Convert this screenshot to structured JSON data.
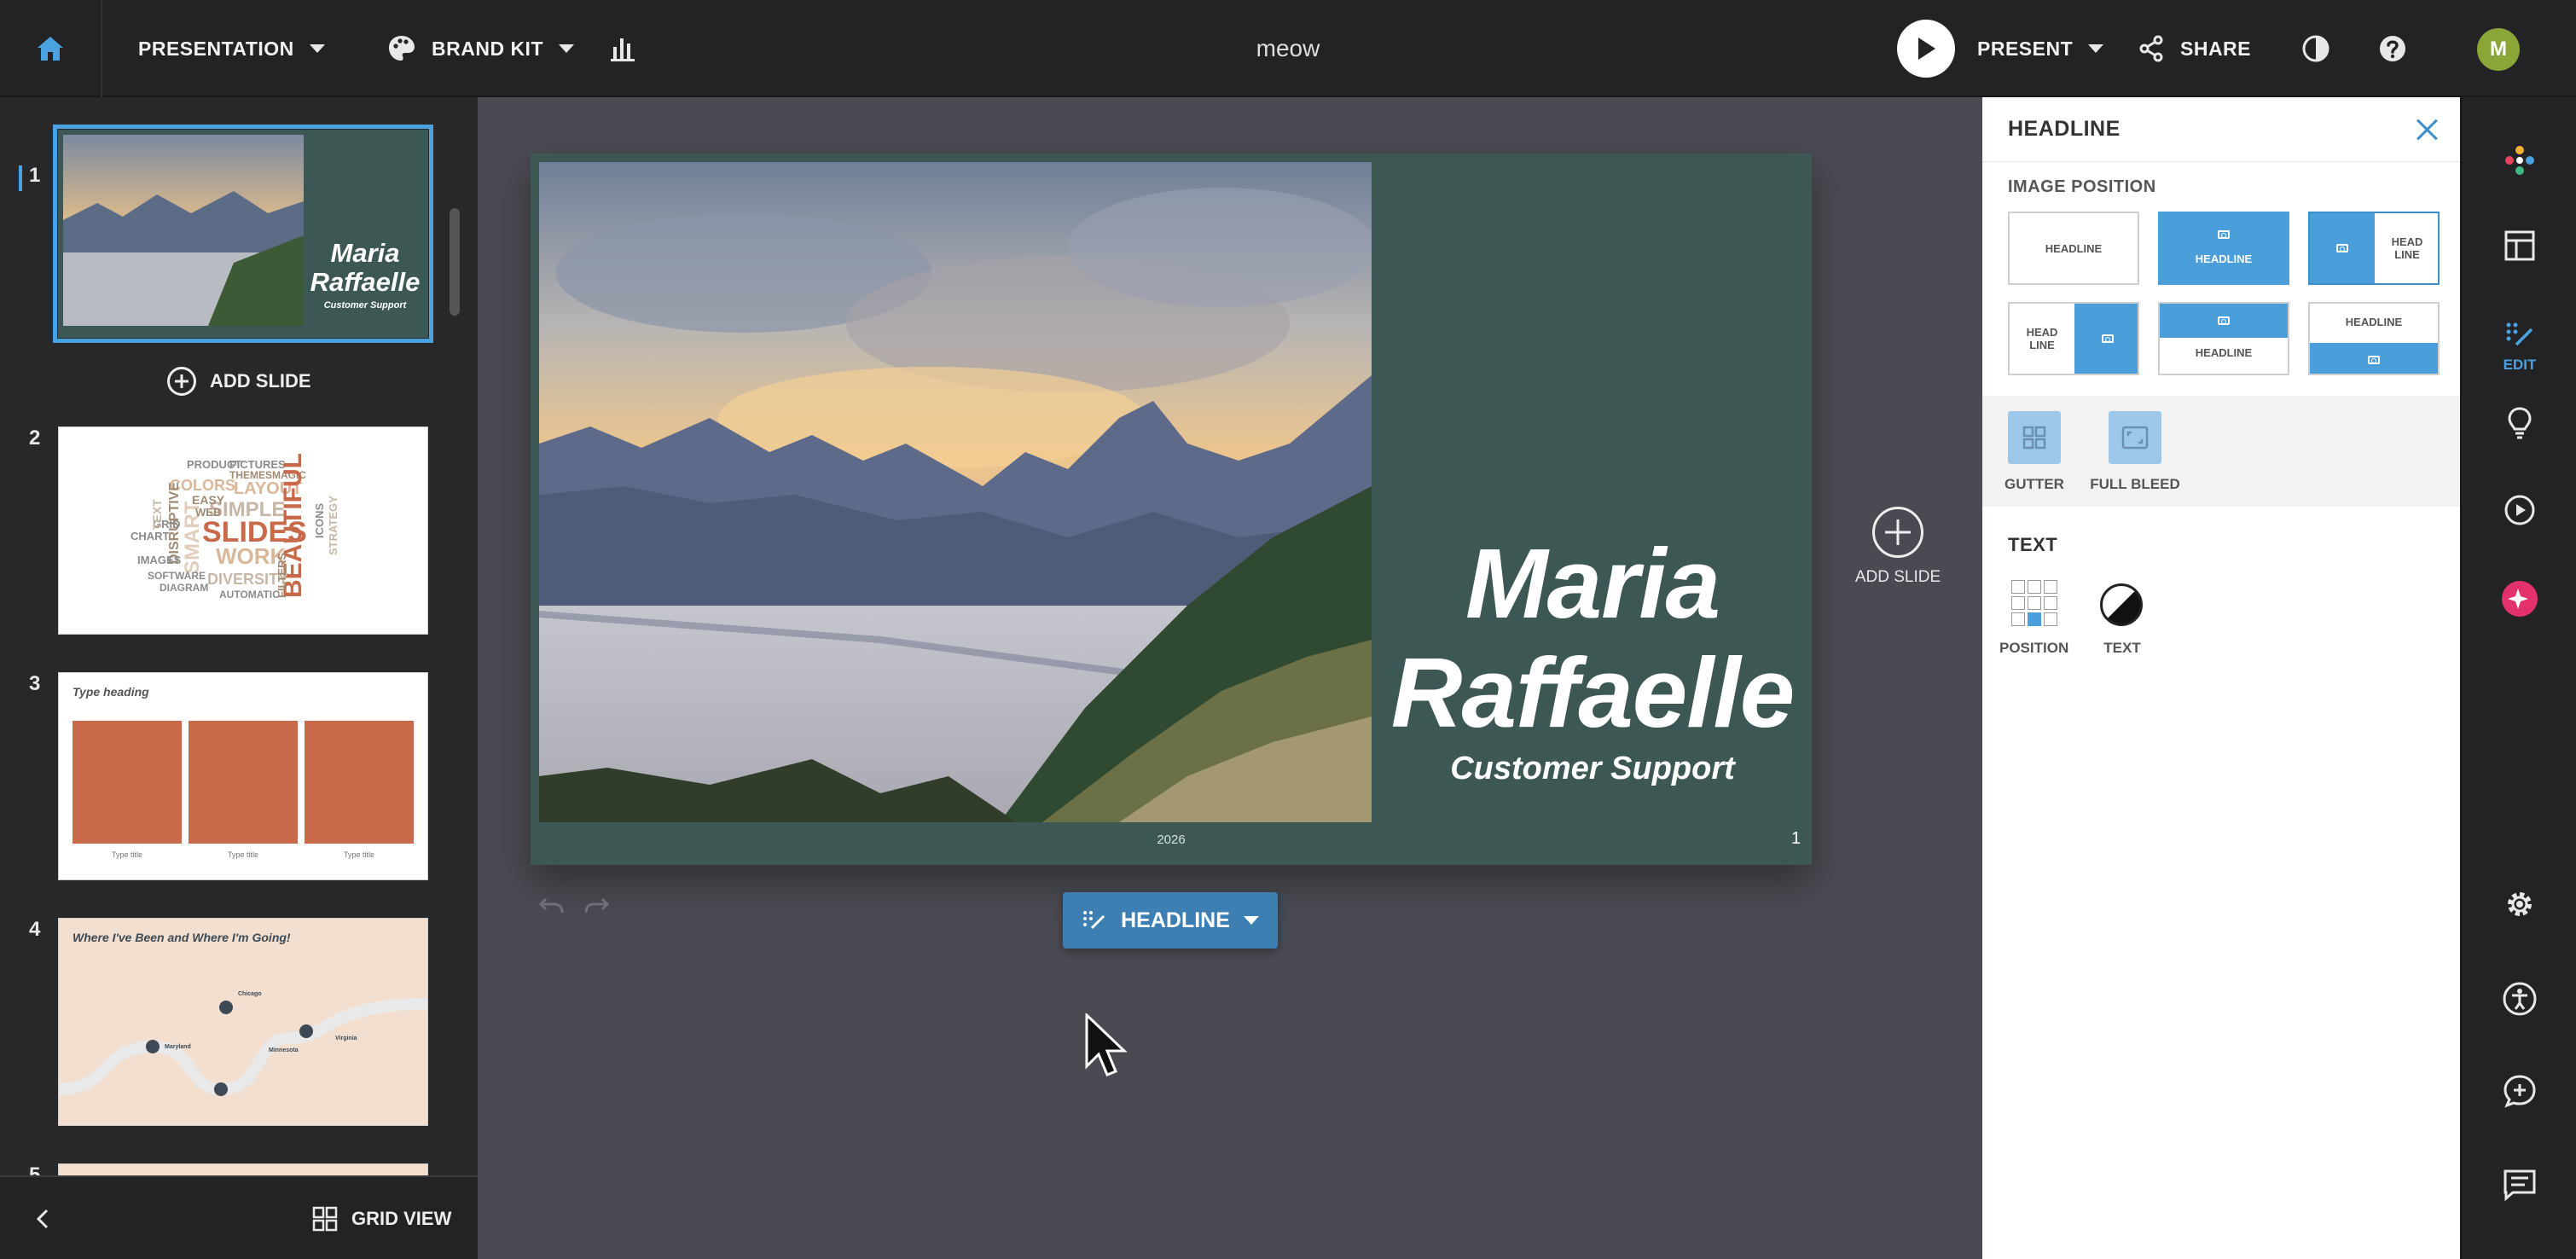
{
  "topbar": {
    "presentation_label": "PRESENTATION",
    "brand_kit_label": "BRAND KIT",
    "doc_title": "meow",
    "present_label": "PRESENT",
    "share_label": "SHARE",
    "avatar_initial": "M"
  },
  "sidebar": {
    "add_slide_label": "ADD SLIDE",
    "grid_view_label": "GRID VIEW",
    "slides": [
      {
        "number": "1",
        "title": "Maria Raffaelle",
        "subtitle": "Customer Support"
      },
      {
        "number": "2"
      },
      {
        "number": "3",
        "heading": "Type heading",
        "captions": [
          "Type title",
          "Type title",
          "Type title"
        ]
      },
      {
        "number": "4",
        "heading": "Where I've Been and Where I'm Going!",
        "places": [
          "Maryland",
          "Chicago",
          "Minnesota",
          "Virginia"
        ]
      },
      {
        "number": "5"
      }
    ],
    "word_cloud": [
      "PRODUCT",
      "PICTURES",
      "THEMES",
      "MAGIC",
      "COLORS",
      "LAYOUT",
      "SLIDES",
      "SIMPLE",
      "BEAUTIFUL",
      "WORK",
      "DIVERSITY",
      "SMART",
      "DISRUPTIVE",
      "IMAGES",
      "SOFTWARE",
      "DIAGRAM",
      "AUTOMATIC",
      "ICONS",
      "EASY",
      "WEB",
      "GRID",
      "CHART",
      "TEXT",
      "FILTERS",
      "STRATEGY"
    ]
  },
  "slide": {
    "title": "Maria Raffaelle",
    "subtitle": "Customer Support",
    "year": "2026",
    "page_number": "1",
    "add_slide_label": "ADD SLIDE",
    "layout_button_label": "HEADLINE"
  },
  "edit_panel": {
    "title": "HEADLINE",
    "image_position_label": "IMAGE POSITION",
    "options": [
      {
        "text": "HEADLINE"
      },
      {
        "text": "HEADLINE"
      },
      {
        "text": "HEAD LINE"
      },
      {
        "text": "HEAD LINE"
      },
      {
        "text": "HEADLINE"
      },
      {
        "text": "HEADLINE"
      }
    ],
    "gutter_label": "GUTTER",
    "full_bleed_label": "FULL BLEED",
    "text_section_label": "TEXT",
    "position_label": "POSITION",
    "text_label": "TEXT"
  },
  "rail": {
    "edit_label": "EDIT"
  },
  "colors": {
    "accent": "#4aa3e0",
    "slide_bg": "#3d5755",
    "thumb_block": "#c8694a",
    "thumb_cream": "#f3dfcf"
  }
}
